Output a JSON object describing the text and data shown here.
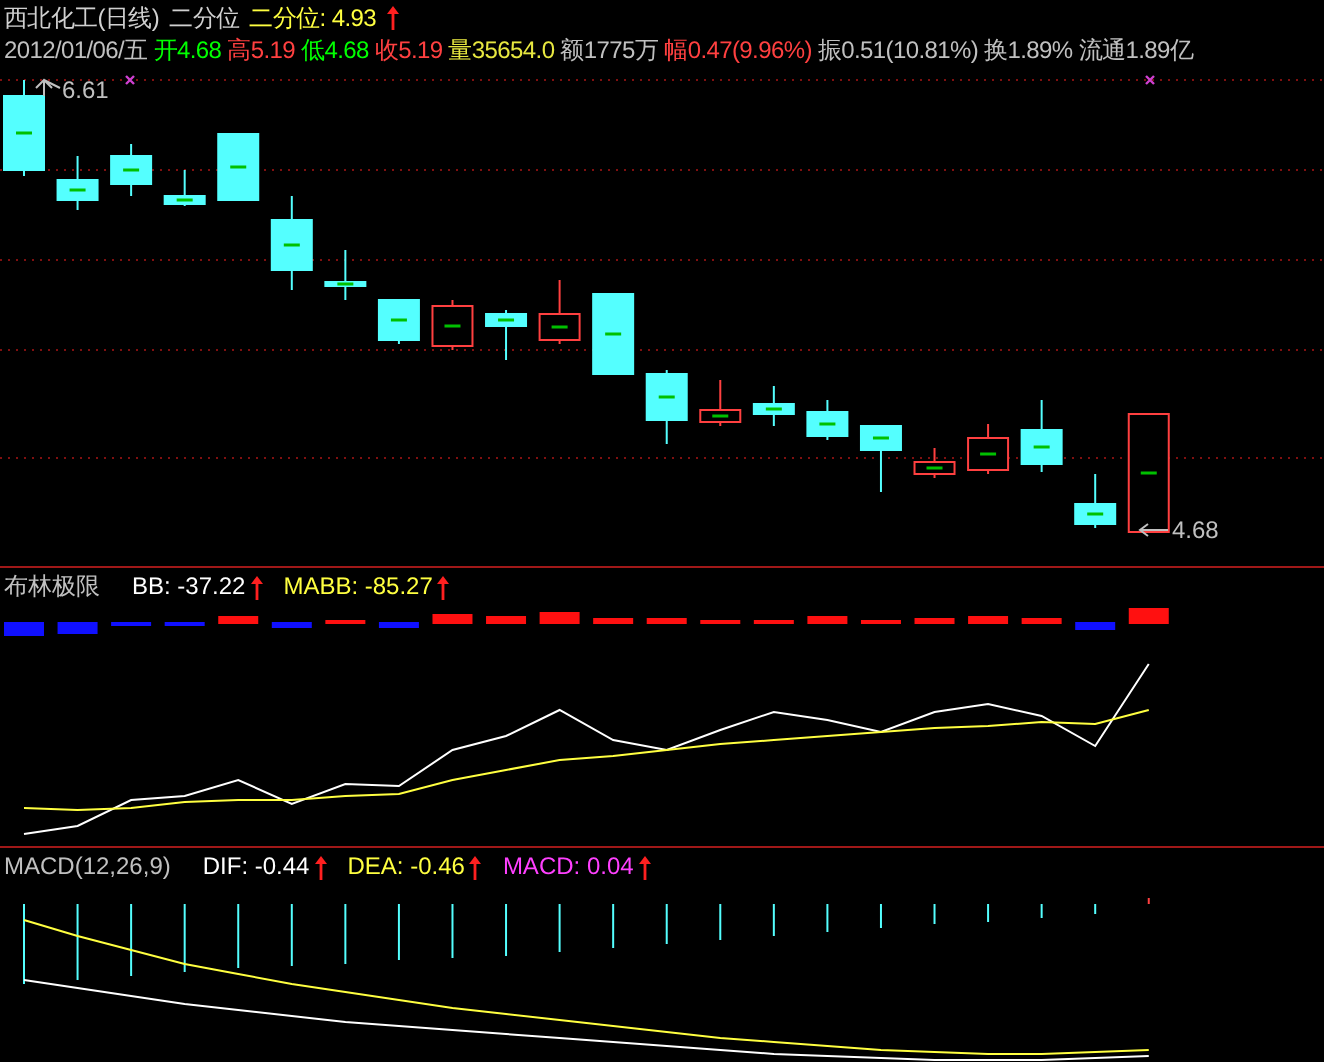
{
  "title": {
    "security": "西北化工(日线)",
    "indicator": "二分位",
    "reading": "二分位: 4.93",
    "rising": true
  },
  "quote": [
    {
      "text": "2012/01/06/五",
      "color": "#c0c0c0"
    },
    {
      "text": "开4.68",
      "color": "#00ff00"
    },
    {
      "text": "高5.19",
      "color": "#ff4040"
    },
    {
      "text": "低4.68",
      "color": "#00ff00"
    },
    {
      "text": "收5.19",
      "color": "#ff4040"
    },
    {
      "text": "量35654.0",
      "color": "#e8e840"
    },
    {
      "text": "额1775万",
      "color": "#c0c0c0"
    },
    {
      "text": "幅0.47(9.96%)",
      "color": "#ff4040"
    },
    {
      "text": "振0.51(10.81%)",
      "color": "#c0c0c0"
    },
    {
      "text": "换1.89%",
      "color": "#c0c0c0"
    },
    {
      "text": "流通1.89亿",
      "color": "#c0c0c0"
    }
  ],
  "price_chart": {
    "high_label": "6.61",
    "low_label": "4.68"
  },
  "panels": [
    {
      "name": "布林极限",
      "values": [
        {
          "label": "BB: -37.22",
          "color": "#ffffff",
          "rising": true
        },
        {
          "label": "MABB: -85.27",
          "color": "#ffff40",
          "rising": true
        }
      ]
    },
    {
      "name": "MACD(12,26,9)",
      "values": [
        {
          "label": "DIF: -0.44",
          "color": "#ffffff",
          "rising": true
        },
        {
          "label": "DEA: -0.46",
          "color": "#ffff40",
          "rising": true
        },
        {
          "label": "MACD: 0.04",
          "color": "#ff40ff",
          "rising": true
        }
      ]
    }
  ]
}
